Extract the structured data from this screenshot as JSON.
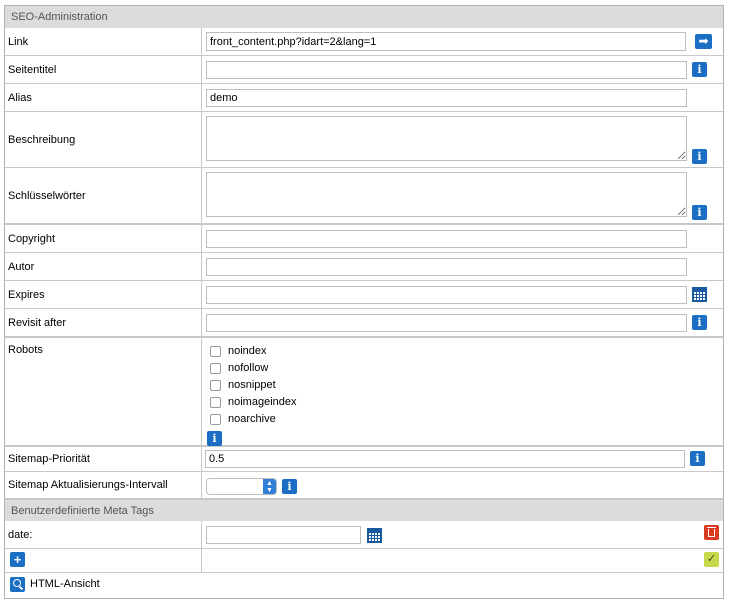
{
  "seo_header": "SEO-Administration",
  "link": {
    "label": "Link",
    "value": "front_content.php?idart=2&lang=1",
    "go_icon": "arrow-right-icon"
  },
  "title": {
    "label": "Seitentitel",
    "value": ""
  },
  "alias": {
    "label": "Alias",
    "value": "demo"
  },
  "description": {
    "label": "Beschreibung",
    "value": ""
  },
  "keywords": {
    "label": "Schlüsselwörter",
    "value": ""
  },
  "copyright": {
    "label": "Copyright",
    "value": ""
  },
  "author": {
    "label": "Autor",
    "value": ""
  },
  "expires": {
    "label": "Expires",
    "value": ""
  },
  "revisit": {
    "label": "Revisit after",
    "value": ""
  },
  "robots": {
    "label": "Robots",
    "options": [
      {
        "label": "noindex",
        "checked": false
      },
      {
        "label": "nofollow",
        "checked": false
      },
      {
        "label": "nosnippet",
        "checked": false
      },
      {
        "label": "noimageindex",
        "checked": false
      },
      {
        "label": "noarchive",
        "checked": false
      }
    ]
  },
  "sitemap_priority": {
    "label": "Sitemap-Priorität",
    "value": "0.5"
  },
  "sitemap_interval": {
    "label": "Sitemap Aktualisierungs-Intervall",
    "value": ""
  },
  "meta_header": "Benutzerdefinierte Meta Tags",
  "custom_meta": [
    {
      "label": "date:",
      "value": ""
    }
  ],
  "html_view": {
    "label": "HTML-Ansicht"
  },
  "icons": {
    "info": "i",
    "plus": "+",
    "check": "✓",
    "arrow": "➡"
  },
  "colors": {
    "header_bg": "#dcdcdc",
    "accent_blue": "#1a6ec4",
    "delete_red": "#d83a22",
    "confirm_green": "#c8d84a"
  }
}
